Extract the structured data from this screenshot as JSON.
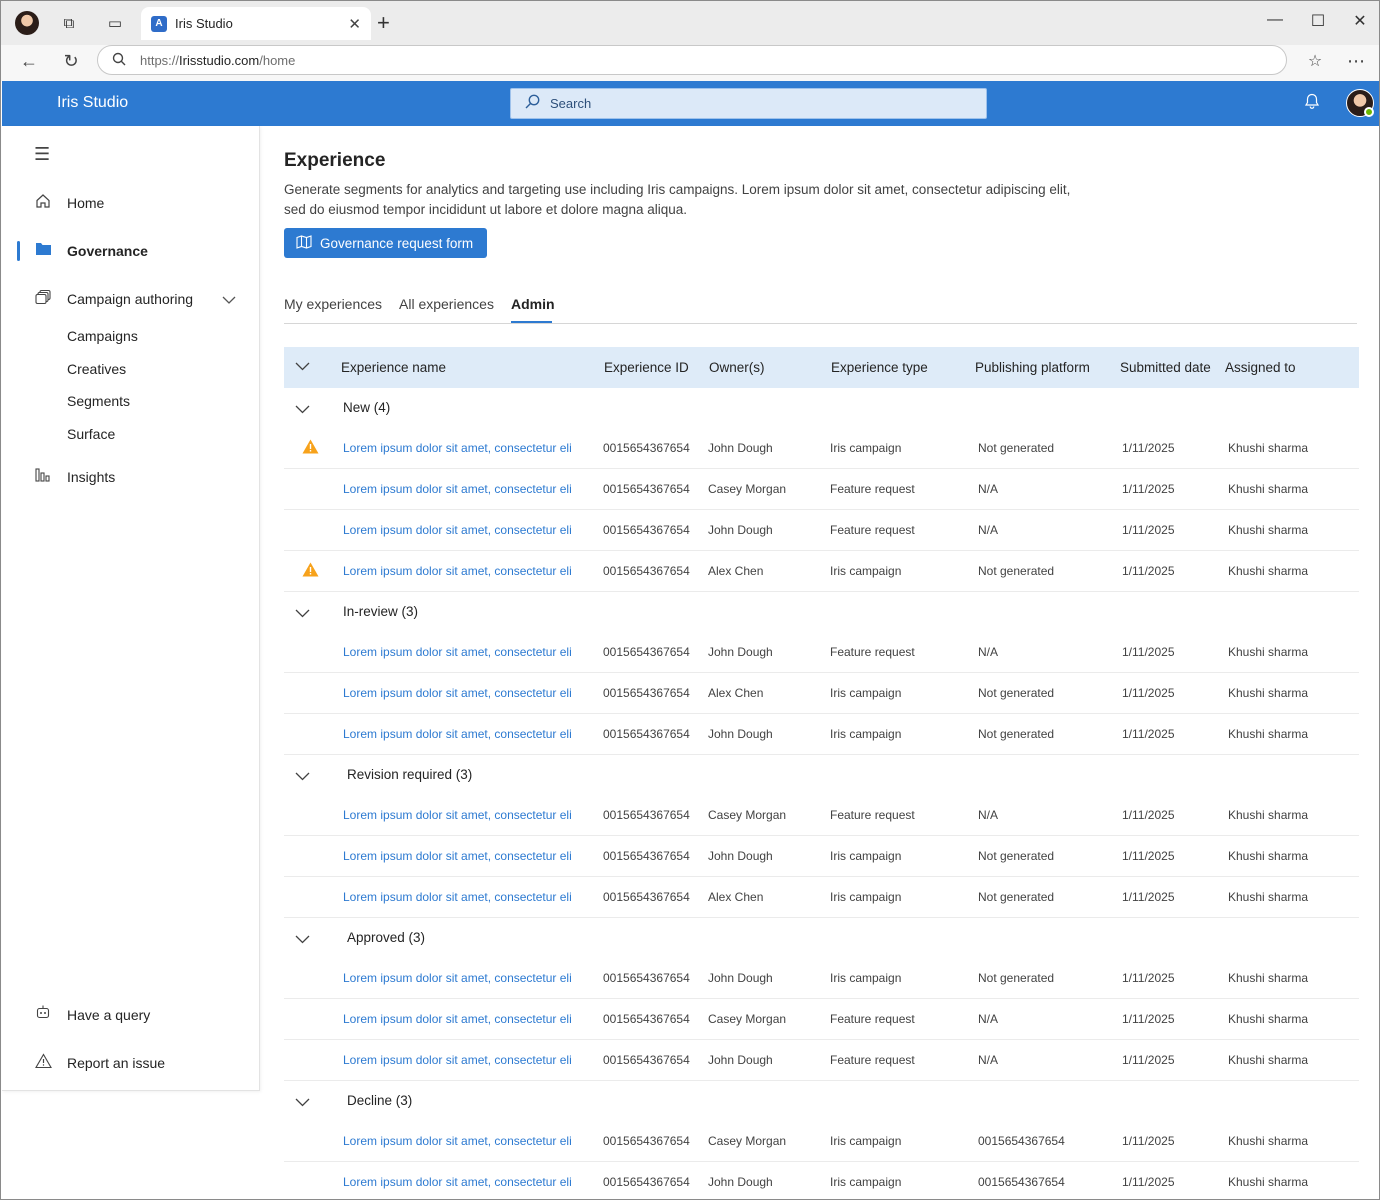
{
  "browser": {
    "tab_title": "Iris Studio",
    "url_prefix": "https://",
    "url_domain": "Irisstudio.com",
    "url_path": "/home"
  },
  "header": {
    "app_title": "Iris Studio",
    "search_placeholder": "Search"
  },
  "sidebar": {
    "items": [
      {
        "label": "Home",
        "icon": "home-icon"
      },
      {
        "label": "Governance",
        "icon": "folder-icon",
        "active": true
      },
      {
        "label": "Campaign authoring",
        "icon": "stack-icon",
        "expanded": true
      },
      {
        "label": "Insights",
        "icon": "bar-chart-icon"
      }
    ],
    "sub_items": [
      "Campaigns",
      "Creatives",
      "Segments",
      "Surface"
    ],
    "footer": [
      {
        "label": "Have a query",
        "icon": "bot-icon"
      },
      {
        "label": "Report an issue",
        "icon": "warning-icon"
      }
    ]
  },
  "main": {
    "title": "Experience",
    "description": "Generate segments for analytics and targeting use including Iris campaigns. Lorem ipsum dolor sit amet, consectetur adipiscing elit, sed do eiusmod tempor incididunt ut labore et dolore magna aliqua.",
    "primary_button": "Governance request form",
    "tabs": [
      "My experiences",
      "All experiences",
      "Admin"
    ],
    "active_tab": "Admin"
  },
  "table": {
    "columns": [
      "Experience name",
      "Experience ID",
      "Owner(s)",
      "Experience type",
      "Publishing platform",
      "Submitted date",
      "Assigned to"
    ],
    "groups": [
      {
        "label": "New (4)",
        "rows": [
          {
            "warning": true,
            "name": "Lorem ipsum dolor sit amet, consectetur eli",
            "id": "0015654367654",
            "owner": "John Dough",
            "type": "Iris campaign",
            "platform": "Not generated",
            "date": "1/11/2025",
            "assigned": "Khushi sharma"
          },
          {
            "warning": false,
            "name": "Lorem ipsum dolor sit amet, consectetur eli",
            "id": "0015654367654",
            "owner": "Casey Morgan",
            "type": "Feature request",
            "platform": "N/A",
            "date": "1/11/2025",
            "assigned": "Khushi sharma"
          },
          {
            "warning": false,
            "name": "Lorem ipsum dolor sit amet, consectetur eli",
            "id": "0015654367654",
            "owner": "John Dough",
            "type": "Feature request",
            "platform": "N/A",
            "date": "1/11/2025",
            "assigned": "Khushi sharma"
          },
          {
            "warning": true,
            "name": "Lorem ipsum dolor sit amet, consectetur eli",
            "id": "0015654367654",
            "owner": "Alex Chen",
            "type": "Iris campaign",
            "platform": "Not generated",
            "date": "1/11/2025",
            "assigned": "Khushi sharma"
          }
        ]
      },
      {
        "label": "In-review (3)",
        "rows": [
          {
            "warning": false,
            "name": "Lorem ipsum dolor sit amet, consectetur eli",
            "id": "0015654367654",
            "owner": "John Dough",
            "type": "Feature request",
            "platform": "N/A",
            "date": "1/11/2025",
            "assigned": "Khushi sharma"
          },
          {
            "warning": false,
            "name": "Lorem ipsum dolor sit amet, consectetur eli",
            "id": "0015654367654",
            "owner": "Alex Chen",
            "type": "Iris campaign",
            "platform": "Not generated",
            "date": "1/11/2025",
            "assigned": "Khushi sharma"
          },
          {
            "warning": false,
            "name": "Lorem ipsum dolor sit amet, consectetur eli",
            "id": "0015654367654",
            "owner": "John Dough",
            "type": "Iris campaign",
            "platform": "Not generated",
            "date": "1/11/2025",
            "assigned": "Khushi sharma"
          }
        ]
      },
      {
        "label": "Revision required (3)",
        "rows": [
          {
            "warning": false,
            "name": "Lorem ipsum dolor sit amet, consectetur eli",
            "id": "0015654367654",
            "owner": "Casey Morgan",
            "type": "Feature request",
            "platform": "N/A",
            "date": "1/11/2025",
            "assigned": "Khushi sharma"
          },
          {
            "warning": false,
            "name": "Lorem ipsum dolor sit amet, consectetur eli",
            "id": "0015654367654",
            "owner": "John Dough",
            "type": "Iris campaign",
            "platform": "Not generated",
            "date": "1/11/2025",
            "assigned": "Khushi sharma"
          },
          {
            "warning": false,
            "name": "Lorem ipsum dolor sit amet, consectetur eli",
            "id": "0015654367654",
            "owner": "Alex Chen",
            "type": "Iris campaign",
            "platform": "Not generated",
            "date": "1/11/2025",
            "assigned": "Khushi sharma"
          }
        ]
      },
      {
        "label": "Approved (3)",
        "rows": [
          {
            "warning": false,
            "name": "Lorem ipsum dolor sit amet, consectetur eli",
            "id": "0015654367654",
            "owner": "John Dough",
            "type": "Iris campaign",
            "platform": "Not generated",
            "date": "1/11/2025",
            "assigned": "Khushi sharma"
          },
          {
            "warning": false,
            "name": "Lorem ipsum dolor sit amet, consectetur eli",
            "id": "0015654367654",
            "owner": "Casey Morgan",
            "type": "Feature request",
            "platform": "N/A",
            "date": "1/11/2025",
            "assigned": "Khushi sharma"
          },
          {
            "warning": false,
            "name": "Lorem ipsum dolor sit amet, consectetur eli",
            "id": "0015654367654",
            "owner": "John Dough",
            "type": "Feature request",
            "platform": "N/A",
            "date": "1/11/2025",
            "assigned": "Khushi sharma"
          }
        ]
      },
      {
        "label": "Decline (3)",
        "rows": [
          {
            "warning": false,
            "name": "Lorem ipsum dolor sit amet, consectetur eli",
            "id": "0015654367654",
            "owner": "Casey Morgan",
            "type": "Iris campaign",
            "platform": "0015654367654",
            "date": "1/11/2025",
            "assigned": "Khushi sharma"
          },
          {
            "warning": false,
            "name": "Lorem ipsum dolor sit amet, consectetur eli",
            "id": "0015654367654",
            "owner": "John Dough",
            "type": "Iris campaign",
            "platform": "0015654367654",
            "date": "1/11/2025",
            "assigned": "Khushi sharma"
          }
        ]
      }
    ]
  },
  "colors": {
    "accent": "#2d7ad1",
    "header_row_bg": "#deebf8",
    "warning": "#f7a21b"
  }
}
